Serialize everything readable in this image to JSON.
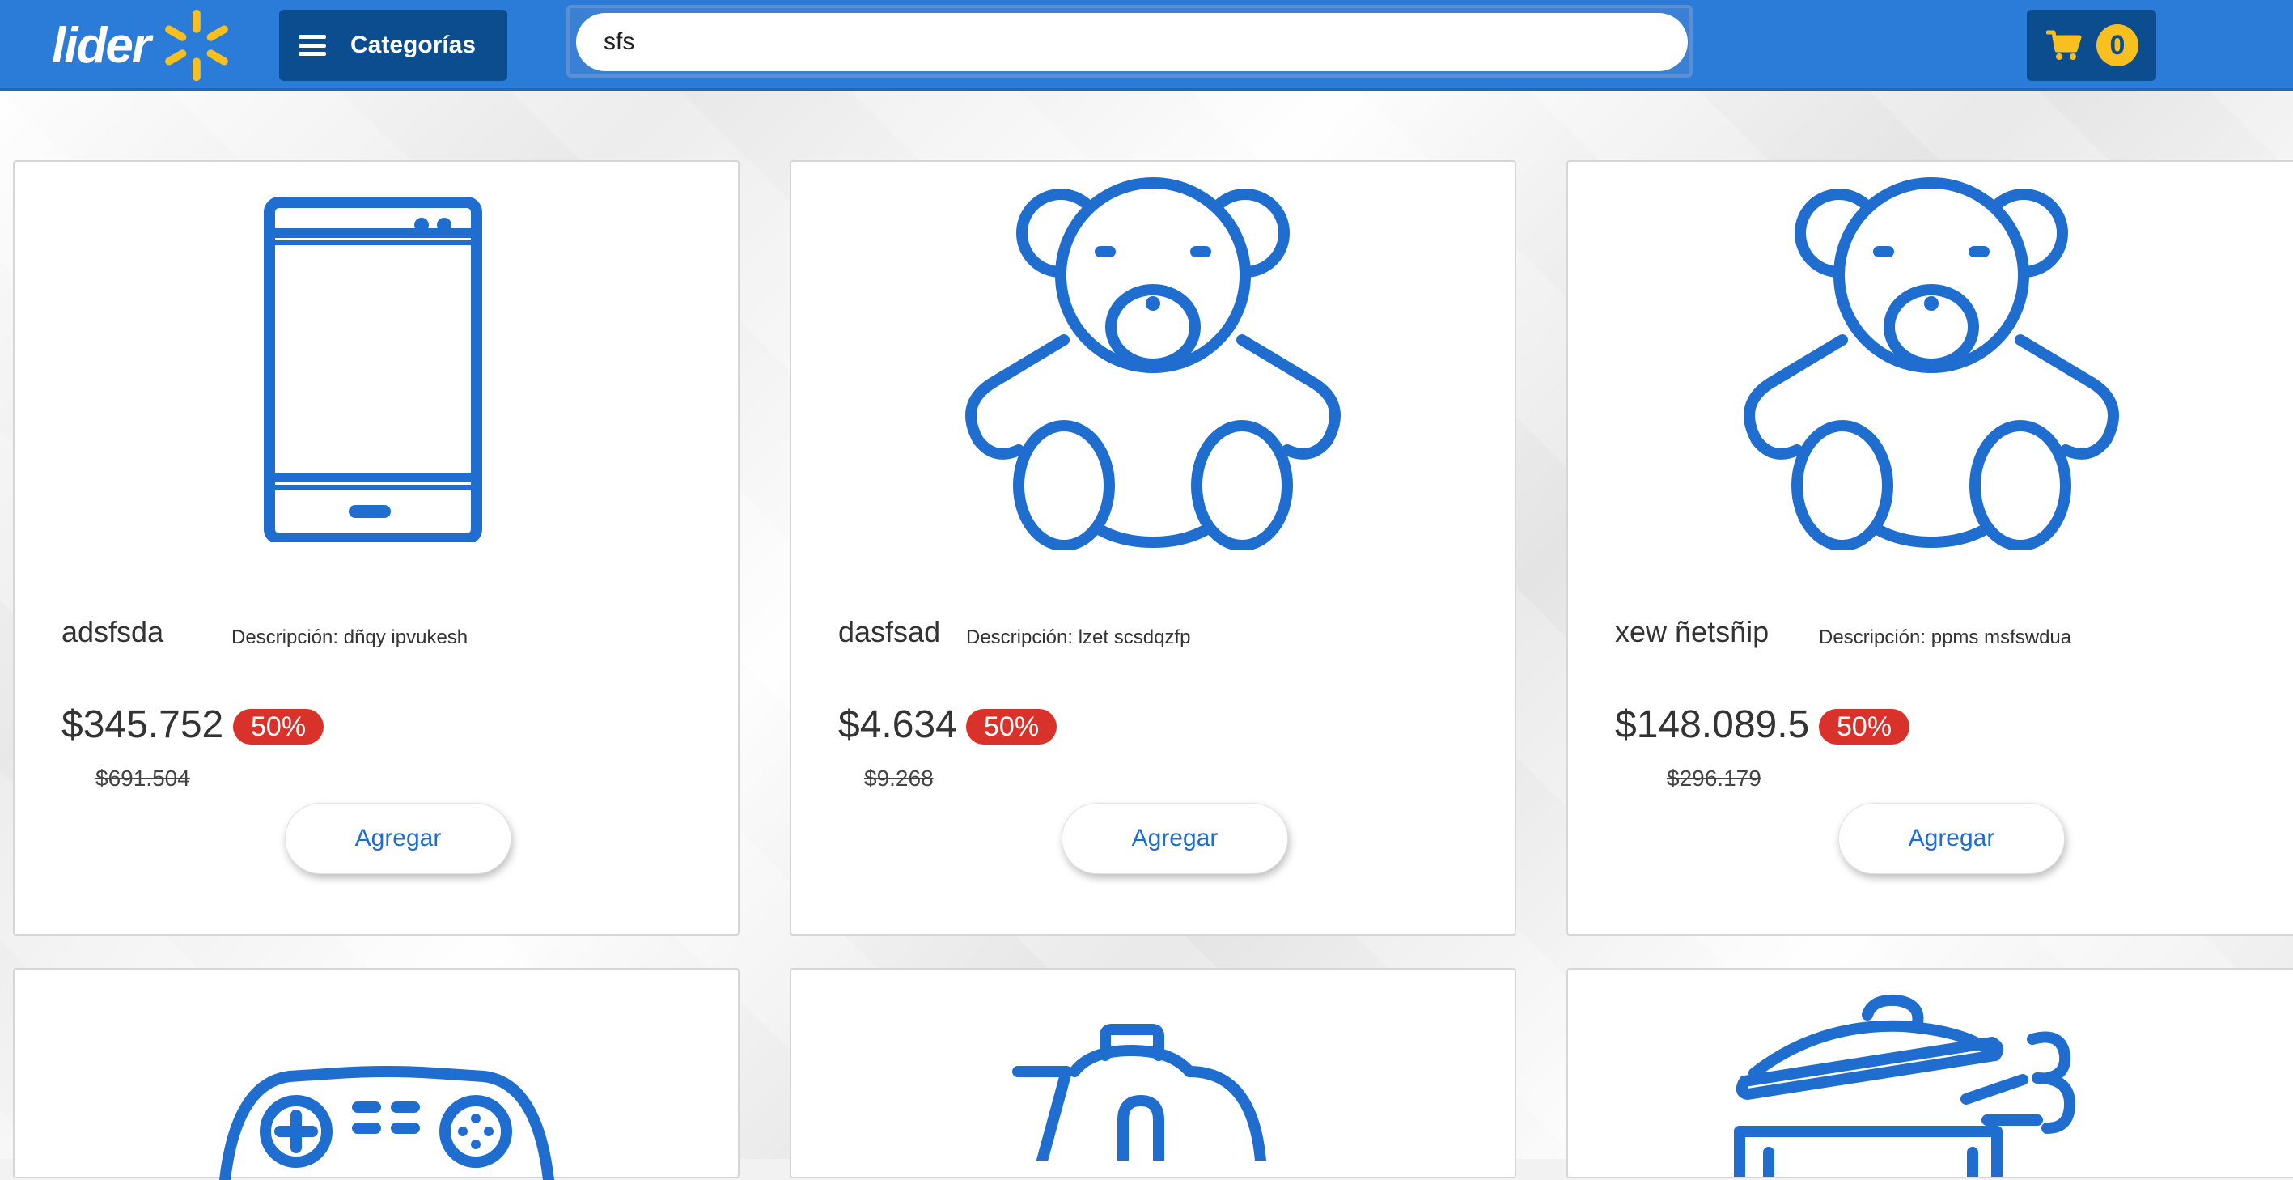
{
  "header": {
    "logo_text": "lider",
    "categories_label": "Categorías",
    "search_value": "sfs",
    "cart_count": "0",
    "brand_color": "#2b7bd8",
    "button_color": "#0c4d8f",
    "accent_color": "#f7c01e"
  },
  "products": [
    {
      "name": "adsfsda",
      "description": "Descripción: dñqy ipvukesh",
      "price": "$345.752",
      "discount": "50%",
      "old_price": "$691.504",
      "button_label": "Agregar",
      "icon": "smartphone-icon"
    },
    {
      "name": "dasfsad",
      "description": "Descripción: lzet scsdqzfp",
      "price": "$4.634",
      "discount": "50%",
      "old_price": "$9.268",
      "button_label": "Agregar",
      "icon": "teddy-bear-icon"
    },
    {
      "name": "xew ñetsñip",
      "description": "Descripción: ppms msfswdua",
      "price": "$148.089.5",
      "discount": "50%",
      "old_price": "$296.179",
      "button_label": "Agregar",
      "icon": "teddy-bear-icon"
    },
    {
      "icon": "gamepad-icon"
    },
    {
      "icon": "kettle-icon"
    },
    {
      "icon": "pot-icon"
    }
  ]
}
